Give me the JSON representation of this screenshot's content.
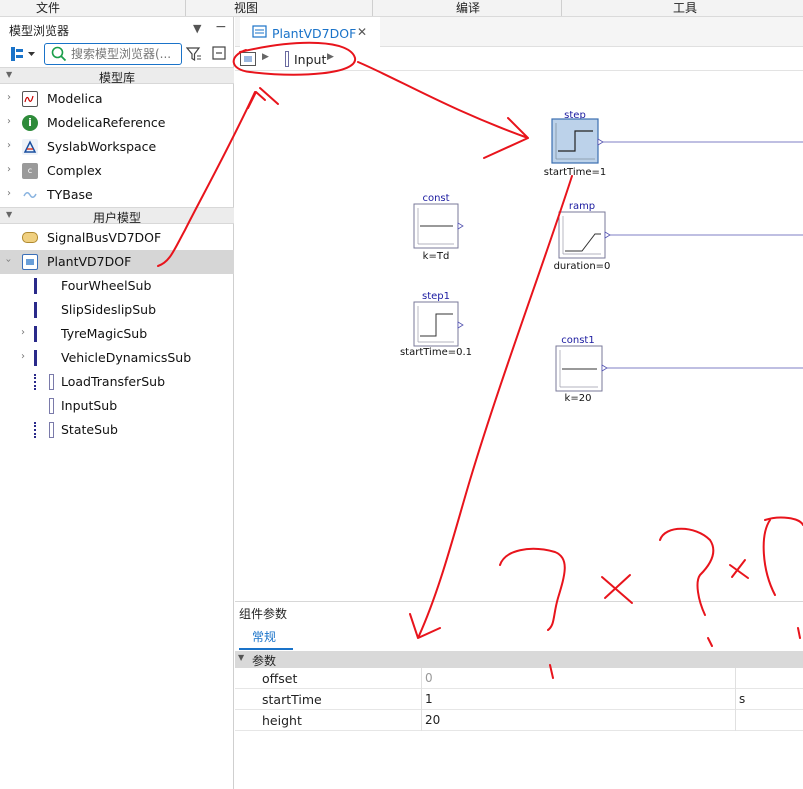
{
  "menu": {
    "file": "文件",
    "view": "视图",
    "compile": "编译",
    "tools": "工具"
  },
  "browser": {
    "title": "模型浏览器",
    "search_placeholder": "搜索模型浏览器(...",
    "library_header": "模型库",
    "libraries": [
      {
        "label": "Modelica"
      },
      {
        "label": "ModelicaReference"
      },
      {
        "label": "SyslabWorkspace"
      },
      {
        "label": "Complex"
      },
      {
        "label": "TYBase"
      }
    ],
    "user_header": "用户模型",
    "user_models": [
      {
        "label": "SignalBusVD7DOF"
      },
      {
        "label": "PlantVD7DOF"
      }
    ],
    "children": [
      {
        "label": "FourWheelSub"
      },
      {
        "label": "SlipSideslipSub"
      },
      {
        "label": "TyreMagicSub"
      },
      {
        "label": "VehicleDynamicsSub"
      },
      {
        "label": "LoadTransferSub"
      },
      {
        "label": "InputSub"
      },
      {
        "label": "StateSub"
      }
    ]
  },
  "editor": {
    "tab_label": "PlantVD7DOF",
    "breadcrumb": "Input"
  },
  "diagram": {
    "blocks": [
      {
        "name": "step",
        "param": "startTime=1"
      },
      {
        "name": "const",
        "param": "k=Td"
      },
      {
        "name": "ramp",
        "param": "duration=0"
      },
      {
        "name": "step1",
        "param": "startTime=0.1"
      },
      {
        "name": "const1",
        "param": "k=20"
      }
    ]
  },
  "params": {
    "title": "组件参数",
    "tab": "常规",
    "group": "参数",
    "rows": [
      {
        "name": "offset",
        "value": "0",
        "unit": ""
      },
      {
        "name": "startTime",
        "value": "1",
        "unit": "s"
      },
      {
        "name": "height",
        "value": "20",
        "unit": ""
      }
    ]
  },
  "colors": {
    "accent": "#1a73c9",
    "annotation": "#e8141c",
    "block_border": "#7a7a9a",
    "port": "#5454b0"
  }
}
